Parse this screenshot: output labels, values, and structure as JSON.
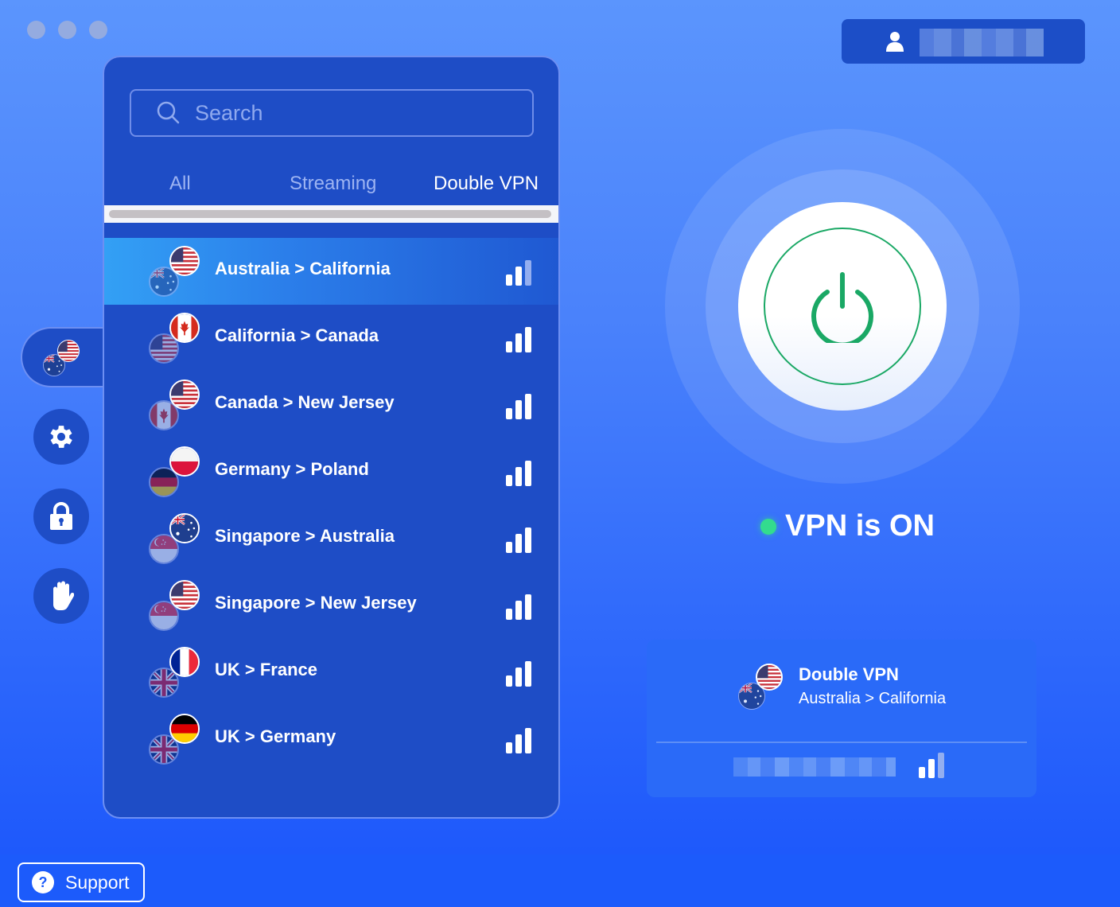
{
  "window": {
    "controls": [
      "close",
      "minimize",
      "maximize"
    ]
  },
  "account": {
    "icon": "user-icon",
    "name_redacted": true
  },
  "search": {
    "placeholder": "Search",
    "value": ""
  },
  "tabs": [
    {
      "label": "All",
      "active": false
    },
    {
      "label": "Streaming",
      "active": false
    },
    {
      "label": "Double VPN",
      "active": true
    }
  ],
  "servers": [
    {
      "label": "Australia > California",
      "entry_flag": "australia",
      "exit_flag": "usa",
      "signal": 2,
      "signal_max": 3,
      "selected": true
    },
    {
      "label": "California > Canada",
      "entry_flag": "usa",
      "exit_flag": "canada",
      "signal": 3,
      "signal_max": 3,
      "selected": false
    },
    {
      "label": "Canada > New Jersey",
      "entry_flag": "canada",
      "exit_flag": "usa",
      "signal": 3,
      "signal_max": 3,
      "selected": false
    },
    {
      "label": "Germany > Poland",
      "entry_flag": "germany",
      "exit_flag": "poland",
      "signal": 3,
      "signal_max": 3,
      "selected": false
    },
    {
      "label": "Singapore > Australia",
      "entry_flag": "singapore",
      "exit_flag": "australia",
      "signal": 3,
      "signal_max": 3,
      "selected": false
    },
    {
      "label": "Singapore > New Jersey",
      "entry_flag": "singapore",
      "exit_flag": "usa",
      "signal": 3,
      "signal_max": 3,
      "selected": false
    },
    {
      "label": "UK > France",
      "entry_flag": "uk",
      "exit_flag": "france",
      "signal": 3,
      "signal_max": 3,
      "selected": false
    },
    {
      "label": "UK > Germany",
      "entry_flag": "uk",
      "exit_flag": "germany",
      "signal": 3,
      "signal_max": 3,
      "selected": false
    }
  ],
  "sidebar": {
    "items": [
      {
        "name": "locations",
        "icon": "double-flag-icon",
        "active": true
      },
      {
        "name": "settings",
        "icon": "gear-icon"
      },
      {
        "name": "security",
        "icon": "lock-icon"
      },
      {
        "name": "blocker",
        "icon": "hand-icon"
      }
    ]
  },
  "status": {
    "text": "VPN is ON",
    "connected": true,
    "color": "#33dc8e"
  },
  "connection": {
    "title": "Double VPN",
    "route": "Australia > California",
    "ip_redacted": true,
    "signal": 2,
    "signal_max": 3
  },
  "footer": {
    "support_label": "Support",
    "support_icon": "?"
  },
  "colors": {
    "panel": "#1e4dc6",
    "accent_green": "#1aa865",
    "status_dot": "#33dc8e",
    "selected_row_start": "#33a0f5"
  }
}
